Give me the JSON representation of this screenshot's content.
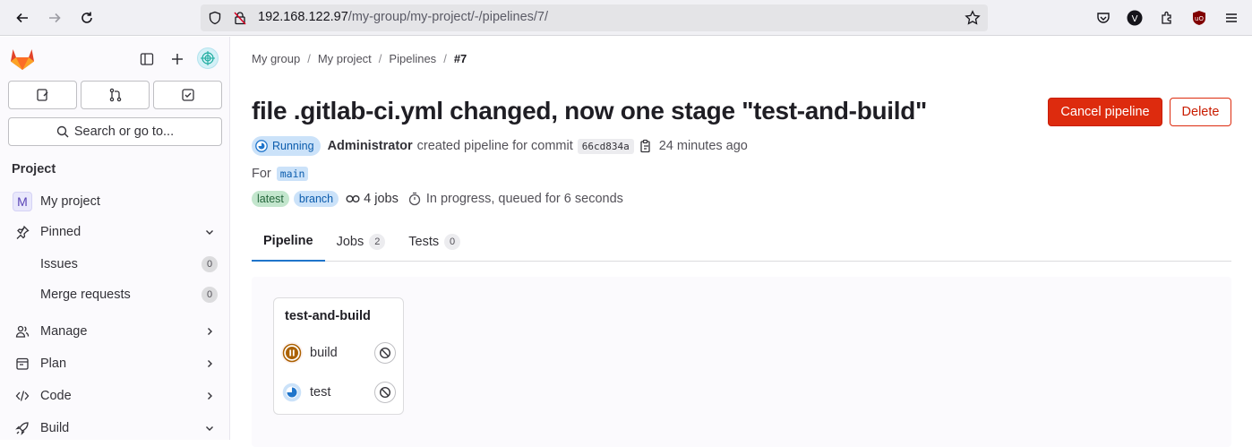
{
  "browser": {
    "url_host": "192.168.122.97",
    "url_path": "/my-group/my-project/-/pipelines/7/"
  },
  "sidebar": {
    "search_label": "Search or go to...",
    "section_title": "Project",
    "project_avatar_letter": "M",
    "project_name": "My project",
    "pinned_label": "Pinned",
    "pinned_items": [
      {
        "label": "Issues",
        "count": "0"
      },
      {
        "label": "Merge requests",
        "count": "0"
      }
    ],
    "nav_items": [
      {
        "label": "Manage"
      },
      {
        "label": "Plan"
      },
      {
        "label": "Code"
      },
      {
        "label": "Build"
      }
    ]
  },
  "breadcrumb": {
    "items": [
      "My group",
      "My project",
      "Pipelines"
    ],
    "current": "#7"
  },
  "pipeline": {
    "title": "file .gitlab-ci.yml changed, now one stage \"test-and-build\"",
    "cancel_label": "Cancel pipeline",
    "delete_label": "Delete",
    "status": "Running",
    "author": "Administrator",
    "created_text": "created pipeline for commit",
    "sha": "66cd834a",
    "time_ago": "24 minutes ago",
    "for_label": "For",
    "ref": "main",
    "badge_latest": "latest",
    "badge_branch": "branch",
    "jobs_count": "4 jobs",
    "progress": "In progress, queued for 6 seconds"
  },
  "tabs": [
    {
      "label": "Pipeline",
      "count": ""
    },
    {
      "label": "Jobs",
      "count": "2"
    },
    {
      "label": "Tests",
      "count": "0"
    }
  ],
  "stage": {
    "name": "test-and-build",
    "jobs": [
      {
        "name": "build",
        "status": "paused-icon",
        "color": "#ab6100"
      },
      {
        "name": "test",
        "status": "running-icon",
        "color": "#1f75cb"
      }
    ]
  },
  "colors": {
    "accent": "#1f75cb",
    "danger": "#dd2b0e"
  }
}
